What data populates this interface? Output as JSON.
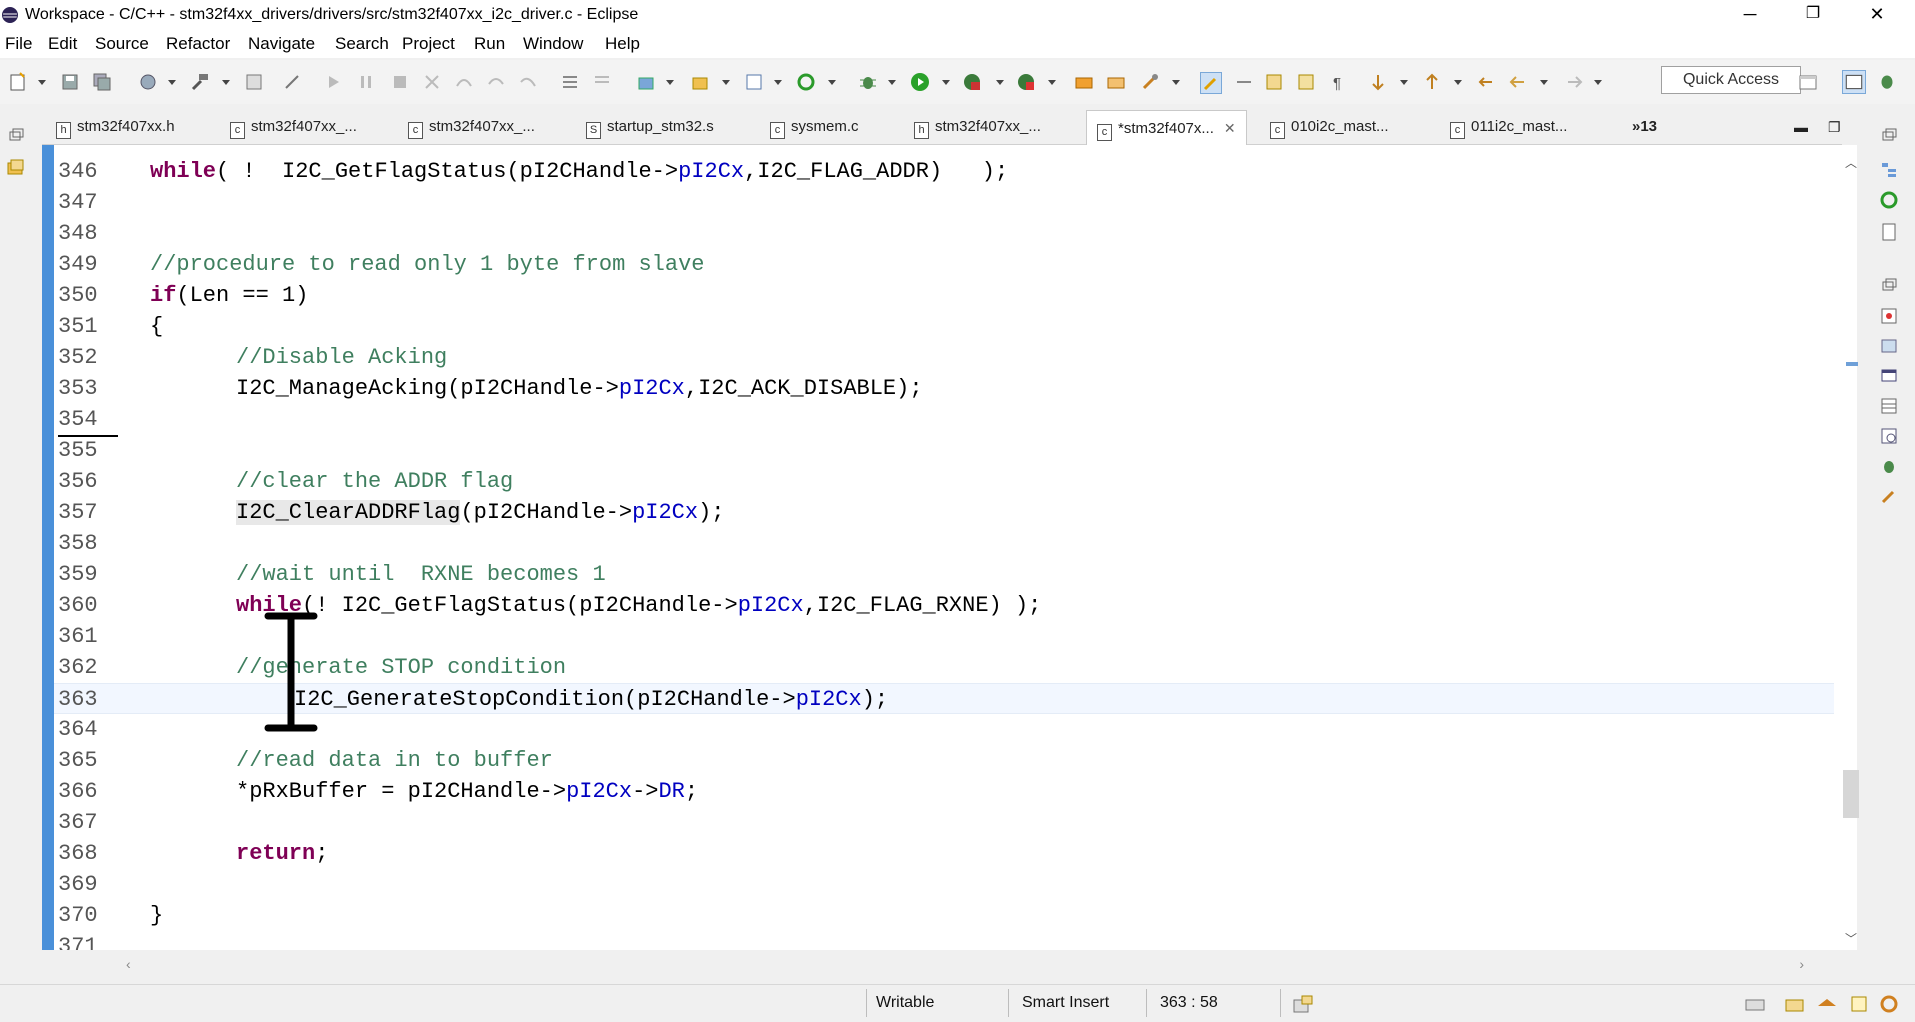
{
  "window": {
    "title": "Workspace - C/C++ - stm32f4xx_drivers/drivers/src/stm32f407xx_i2c_driver.c - Eclipse",
    "minimize": "─",
    "maximize": "❐",
    "close": "✕"
  },
  "menu": [
    "File",
    "Edit",
    "Source",
    "Refactor",
    "Navigate",
    "Search",
    "Project",
    "Run",
    "Window",
    "Help"
  ],
  "quick_access": "Quick Access",
  "tabs": [
    {
      "label": "stm32f407xx.h",
      "type": "h"
    },
    {
      "label": "stm32f407xx_...",
      "type": "c"
    },
    {
      "label": "stm32f407xx_...",
      "type": "c"
    },
    {
      "label": "startup_stm32.s",
      "type": "s"
    },
    {
      "label": "sysmem.c",
      "type": "c"
    },
    {
      "label": "stm32f407xx_...",
      "type": "h"
    },
    {
      "label": "*stm32f407x...",
      "type": "c",
      "active": true
    },
    {
      "label": "010i2c_mast...",
      "type": "c"
    },
    {
      "label": "011i2c_mast...",
      "type": "c"
    }
  ],
  "tabs_overflow": "»13",
  "code": {
    "l346": {
      "num": "346",
      "kw": "while",
      "rest1": "( !  I2C_GetFlagStatus(pI2CHandle->",
      "fld": "pI2Cx",
      "rest2": ",I2C_FLAG_ADDR)   );"
    },
    "l347": {
      "num": "347"
    },
    "l348": {
      "num": "348"
    },
    "l349": {
      "num": "349",
      "cm": "//procedure to read only 1 byte from slave"
    },
    "l350": {
      "num": "350",
      "kw": "if",
      "rest": "(Len == 1)"
    },
    "l351": {
      "num": "351",
      "text": "{"
    },
    "l352": {
      "num": "352",
      "cm": "//Disable Acking"
    },
    "l353": {
      "num": "353",
      "pre": "I2C_ManageAcking(pI2CHandle->",
      "fld": "pI2Cx",
      "post": ",I2C_ACK_DISABLE);"
    },
    "l354": {
      "num": "354"
    },
    "l355": {
      "num": "355"
    },
    "l356": {
      "num": "356",
      "cm": "//clear the ADDR flag"
    },
    "l357": {
      "num": "357",
      "occ": "I2C_ClearADDRFlag",
      "pre": "(pI2CHandle->",
      "fld": "pI2Cx",
      "post": ");"
    },
    "l358": {
      "num": "358"
    },
    "l359": {
      "num": "359",
      "cm": "//wait until  RXNE becomes 1"
    },
    "l360": {
      "num": "360",
      "kw": "while",
      "pre": "(! I2C_GetFlagStatus(pI2CHandle->",
      "fld": "pI2Cx",
      "post": ",I2C_FLAG_RXNE) );"
    },
    "l361": {
      "num": "361"
    },
    "l362": {
      "num": "362",
      "cm": "//generate STOP condition"
    },
    "l363": {
      "num": "363",
      "pre": "I2C_GenerateStopCondition(pI2CHandle->",
      "fld": "pI2Cx",
      "post": ");"
    },
    "l364": {
      "num": "364"
    },
    "l365": {
      "num": "365",
      "cm": "//read data in to buffer"
    },
    "l366": {
      "num": "366",
      "pre": "*pRxBuffer = pI2CHandle->",
      "fld": "pI2Cx",
      "mid": "->",
      "fld2": "DR",
      "post": ";"
    },
    "l367": {
      "num": "367"
    },
    "l368": {
      "num": "368",
      "kw": "return",
      "post": ";"
    },
    "l369": {
      "num": "369"
    },
    "l370": {
      "num": "370",
      "text": "}"
    },
    "l371": {
      "num": "371"
    }
  },
  "status": {
    "writable": "Writable",
    "insert_mode": "Smart Insert",
    "position": "363 : 58"
  },
  "colors": {
    "keyword": "#7f0055",
    "comment": "#3f7f5f",
    "field": "#0000c0",
    "ruler": "#4a90d9"
  }
}
